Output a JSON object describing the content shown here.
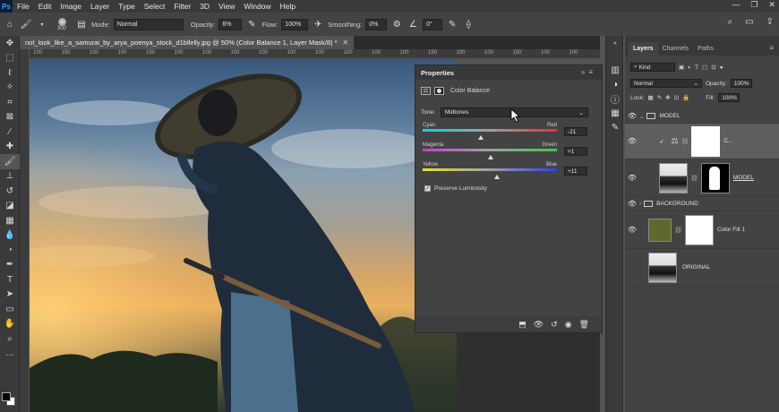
{
  "menubar": {
    "items": [
      "File",
      "Edit",
      "Image",
      "Layer",
      "Type",
      "Select",
      "Filter",
      "3D",
      "View",
      "Window",
      "Help"
    ],
    "app_logo": "Ps"
  },
  "options": {
    "brush_size": "300",
    "mode_label": "Mode:",
    "mode_value": "Normal",
    "opacity_label": "Opacity:",
    "opacity_value": "6%",
    "flow_label": "Flow:",
    "flow_value": "100%",
    "smoothing_label": "Smoothing:",
    "smoothing_value": "0%",
    "angle_value": "0°"
  },
  "document": {
    "tab_title": "not_look_like_a_samurai_by_arya_poenya_stock_d1bllelly.jpg @ 50% (Color Balance 1, Layer Mask/8) *",
    "ruler": [
      "100",
      "150",
      "100",
      "100",
      "150",
      "100",
      "100",
      "100",
      "100",
      "100",
      "100",
      "100",
      "100",
      "100",
      "150",
      "100",
      "100",
      "150",
      "100",
      "100"
    ]
  },
  "properties": {
    "title": "Properties",
    "adjustment_name": "Color Balance",
    "tone_label": "Tone:",
    "tone_value": "Midtones",
    "sliders": [
      {
        "left": "Cyan",
        "right": "Red",
        "value": "-21",
        "pos": 0.43
      },
      {
        "left": "Magenta",
        "right": "Green",
        "value": "+1",
        "pos": 0.505
      },
      {
        "left": "Yellow",
        "right": "Blue",
        "value": "+11",
        "pos": 0.555
      }
    ],
    "preserve_label": "Preserve Luminosity"
  },
  "layers_panel": {
    "tabs": [
      "Layers",
      "Channels",
      "Paths"
    ],
    "filter_value": "Kind",
    "blend_value": "Normal",
    "opacity_label": "Opacity:",
    "opacity_value": "100%",
    "lock_label": "Lock:",
    "fill_label": "Fill:",
    "fill_value": "100%",
    "layers": [
      {
        "name": "MODEL",
        "type": "group"
      },
      {
        "name": "C...",
        "type": "adjustment"
      },
      {
        "name": "MODEL",
        "type": "image"
      },
      {
        "name": "BACKGROUND",
        "type": "group"
      },
      {
        "name": "Color Fill 1",
        "type": "fill"
      },
      {
        "name": "ORIGINAL",
        "type": "image"
      }
    ]
  },
  "colors": {
    "sel_layer": "#5e5e5e",
    "panel": "#434343",
    "accent": "#31a8ff"
  }
}
